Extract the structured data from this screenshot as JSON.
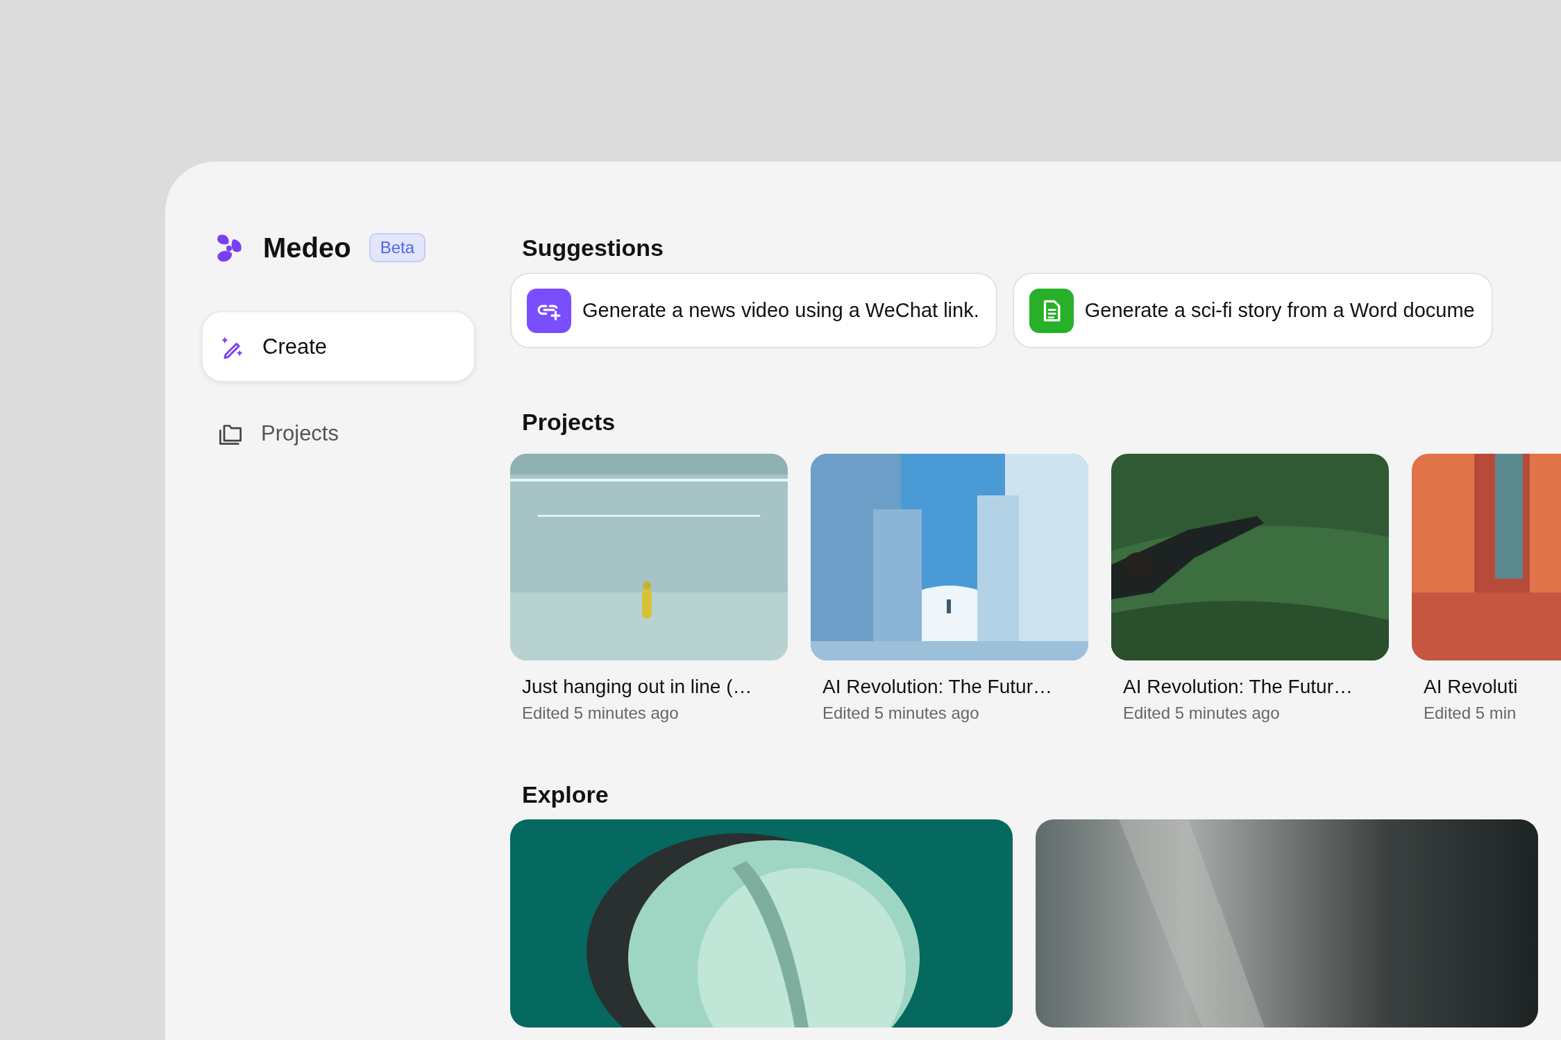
{
  "brand": {
    "name": "Medeo",
    "badge": "Beta"
  },
  "nav": [
    {
      "label": "Create",
      "selected": true
    },
    {
      "label": "Projects",
      "selected": false
    }
  ],
  "suggestions": {
    "title": "Suggestions",
    "items": [
      {
        "text": "Generate a news video using a WeChat link.",
        "color": "#7a4dff"
      },
      {
        "text": "Generate a sci-fi story from a Word docume",
        "color": "#27b02a"
      }
    ]
  },
  "projects": {
    "title": "Projects",
    "items": [
      {
        "title": "Just hanging out in line (…",
        "subtitle": "Edited 5 minutes ago"
      },
      {
        "title": "AI Revolution: The Futur…",
        "subtitle": "Edited 5 minutes ago"
      },
      {
        "title": "AI Revolution: The Futur…",
        "subtitle": "Edited 5 minutes ago"
      },
      {
        "title": "AI Revoluti",
        "subtitle": "Edited 5 min"
      }
    ]
  },
  "explore": {
    "title": "Explore"
  }
}
